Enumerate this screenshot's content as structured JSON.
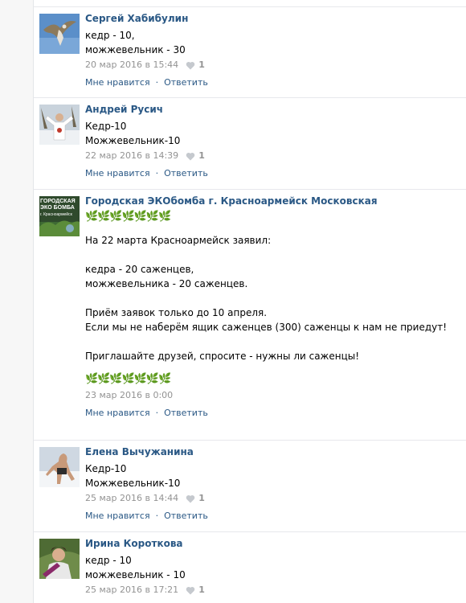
{
  "colors": {
    "link": "#2a5885",
    "meta": "#939393",
    "divider": "#e7e8ec"
  },
  "comments": [
    {
      "author": "Сергей Хабибулин",
      "lines": [
        "кедр - 10,",
        "можжевельник - 30"
      ],
      "date": "20 мар 2016 в 15:44",
      "likes": "1",
      "like_label": "Мне нравится",
      "reply_label": "Ответить",
      "avatar_icon": "bird-avatar"
    },
    {
      "author": "Андрей Русич",
      "lines": [
        "Кедр-10",
        "Можжевельник-10"
      ],
      "date": "22 мар 2016 в 14:39",
      "likes": "1",
      "like_label": "Мне нравится",
      "reply_label": "Ответить",
      "avatar_icon": "person-snow-avatar"
    },
    {
      "author": "Городская ЭКОбомба г. Красноармейск Московская",
      "emoji": "🌿🌿🌿🌿🌿🌿🌿",
      "lines": [
        "На 22 марта Красноармейск заявил:",
        "",
        "кедра - 20 саженцев,",
        "можжевельника - 20 саженцев.",
        "",
        "Приём заявок только до 10 апреля.",
        "Если мы не наберём ящик саженцев (300) саженцы к нам не приедут!",
        "",
        "Приглашайте друзей, спросите - нужны ли саженцы!"
      ],
      "emoji_after": "🌿🌿🌿🌿🌿🌿🌿",
      "date": "23 мар 2016 в 0:00",
      "like_label": "Мне нравится",
      "reply_label": "Ответить",
      "avatar_text": [
        "ГОРОДСКАЯ",
        "ЭКО БОМБА",
        "г. Красноармейск"
      ]
    },
    {
      "author": "Елена Вычужанина",
      "lines": [
        "Кедр-10",
        "Можжевельник-10"
      ],
      "date": "25 мар 2016 в 14:44",
      "likes": "1",
      "like_label": "Мне нравится",
      "reply_label": "Ответить",
      "avatar_icon": "person-snow-avatar"
    },
    {
      "author": "Ирина Короткова",
      "lines": [
        "кедр - 10",
        "можжевельник - 10"
      ],
      "date": "25 мар 2016 в 17:21",
      "likes": "1",
      "avatar_icon": "person-green-avatar"
    }
  ],
  "separator": "·"
}
